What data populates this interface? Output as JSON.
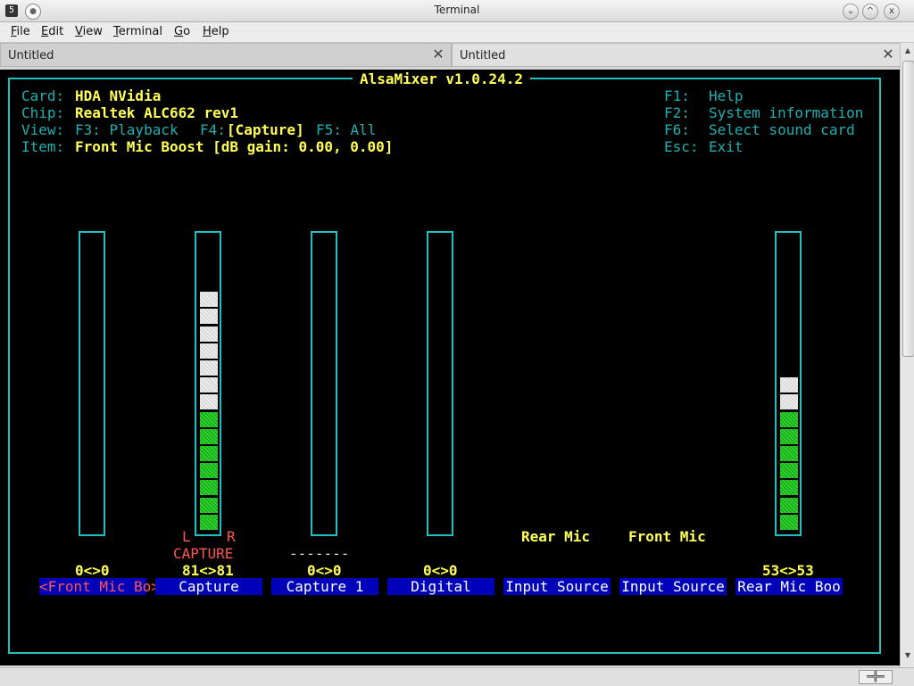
{
  "window": {
    "title": "Terminal",
    "icon_name": "terminal-icon",
    "icon_glyph": "5",
    "buttons": {
      "minimize": "⌄",
      "maximize": "^",
      "close": "x"
    }
  },
  "menu": [
    {
      "accel": "F",
      "rest": "ile"
    },
    {
      "accel": "E",
      "rest": "dit"
    },
    {
      "accel": "V",
      "rest": "iew"
    },
    {
      "accel": "T",
      "rest": "erminal"
    },
    {
      "accel": "G",
      "rest": "o"
    },
    {
      "accel": "H",
      "rest": "elp"
    }
  ],
  "tabs": [
    {
      "label": "Untitled",
      "close": "✕"
    },
    {
      "label": "Untitled",
      "close": "✕"
    }
  ],
  "alsamixer": {
    "title": "AlsaMixer v1.0.24.2",
    "card_label": "Card:",
    "card_value": "HDA NVidia",
    "chip_label": "Chip:",
    "chip_value": "Realtek ALC662 rev1",
    "view_label": "View:",
    "view_f3": "F3: Playback",
    "view_f4_key": "F4:",
    "view_f4_value": "[Capture]",
    "view_f5": "F5: All",
    "item_label": "Item:",
    "item_value": "Front Mic Boost [dB gain: 0.00, 0.00]",
    "help": [
      {
        "key": "F1:",
        "text": "Help"
      },
      {
        "key": "F2:",
        "text": "System information"
      },
      {
        "key": "F6:",
        "text": "Select sound card"
      },
      {
        "key": "Esc:",
        "text": "Exit"
      }
    ],
    "controls": [
      {
        "name": "<Front Mic Bo>",
        "value": "0<>0",
        "selected": true,
        "level_fraction": 0.0
      },
      {
        "name": "Capture",
        "value": "81<>81",
        "selected": false,
        "level_fraction": 0.81,
        "capture_flag": "CAPTURE",
        "left": "L",
        "right": "R"
      },
      {
        "name": "Capture 1",
        "value": "0<>0",
        "selected": false,
        "level_fraction": 0.0,
        "capture_flag": "-------"
      },
      {
        "name": "Digital",
        "value": "0<>0",
        "selected": false,
        "level_fraction": 0.0
      },
      {
        "name": "Input Source",
        "value": "Rear Mic",
        "selected": false
      },
      {
        "name": "Input Source",
        "value": "Front Mic",
        "selected": false
      },
      {
        "name": "Rear Mic Boo",
        "value": "53<>53",
        "selected": false,
        "level_fraction": 0.53
      }
    ]
  },
  "colors": {
    "frame": "#20c0c0",
    "highlight": "#ffff55",
    "channel_bg": "#0000b8",
    "selected": "#ff5555",
    "level_green": "#20c020",
    "level_white": "#e0e0e0"
  }
}
